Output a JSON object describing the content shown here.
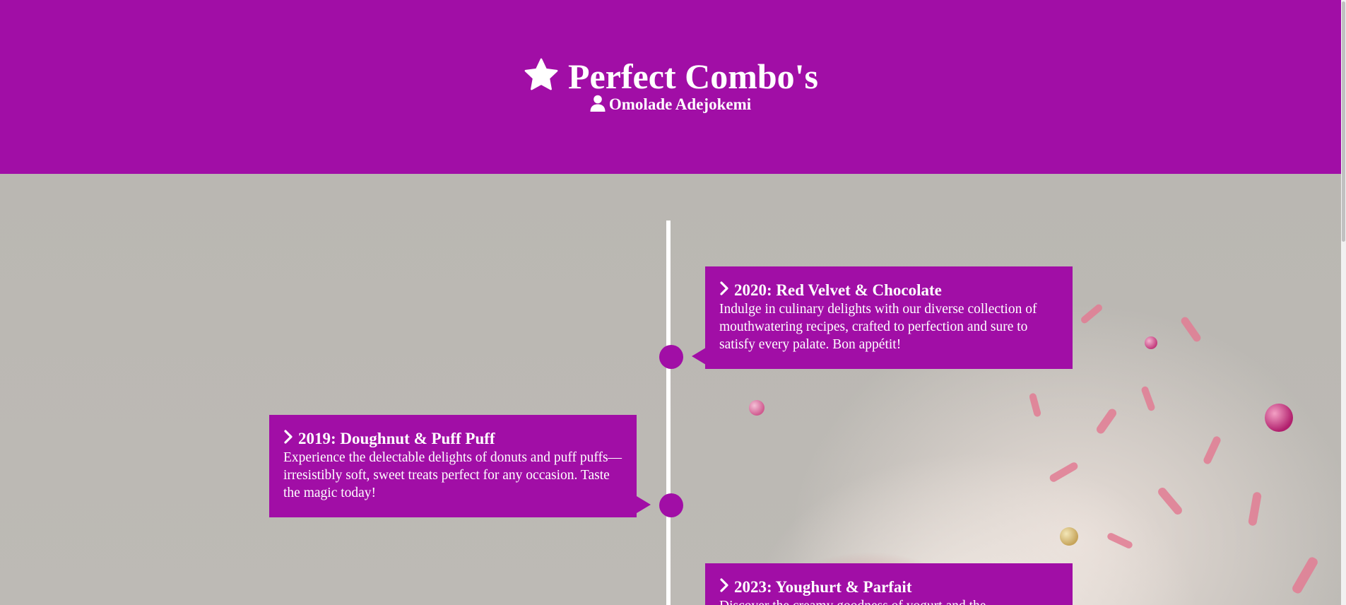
{
  "header": {
    "title": "Perfect Combo's",
    "author": "Omolade Adejokemi",
    "background_color": "#a10ea6",
    "title_icon": "star-icon",
    "author_icon": "user-icon"
  },
  "timeline": {
    "accent_color": "#a10ea6",
    "line_color": "#ffffff",
    "entries": [
      {
        "title": "2020: Red Velvet & Chocolate",
        "text": "Indulge in culinary delights with our diverse collection of mouthwatering recipes, crafted to perfection and sure to satisfy every palate. Bon appétit!",
        "side": "right",
        "icon": "chevron-right-icon"
      },
      {
        "title": "2019: Doughnut & Puff Puff",
        "text": "Experience the delectable delights of donuts and puff puffs—irresistibly soft, sweet treats perfect for any occasion. Taste the magic today!",
        "side": "left",
        "icon": "chevron-right-icon"
      },
      {
        "title": "2023: Youghurt & Parfait",
        "text": "Discover the creamy goodness of yogurt and the",
        "side": "right",
        "icon": "chevron-right-icon"
      }
    ]
  }
}
